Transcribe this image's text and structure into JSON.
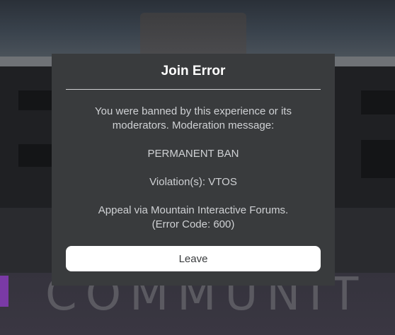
{
  "background": {
    "banner_text": "COMMUNIT"
  },
  "dialog": {
    "title": "Join Error",
    "message_lines": [
      "You were banned by this experience or its\nmoderators. Moderation message:",
      "PERMANENT BAN",
      "Violation(s): VTOS",
      "Appeal via Mountain Interactive Forums.\n(Error Code: 600)"
    ],
    "leave_label": "Leave"
  },
  "colors": {
    "modal_background": "#393b3d",
    "title_text": "#ffffff",
    "body_text": "#cfd1d4",
    "button_background": "#ffffff",
    "button_text": "#393b3d",
    "accent": "#7a3aa6"
  }
}
